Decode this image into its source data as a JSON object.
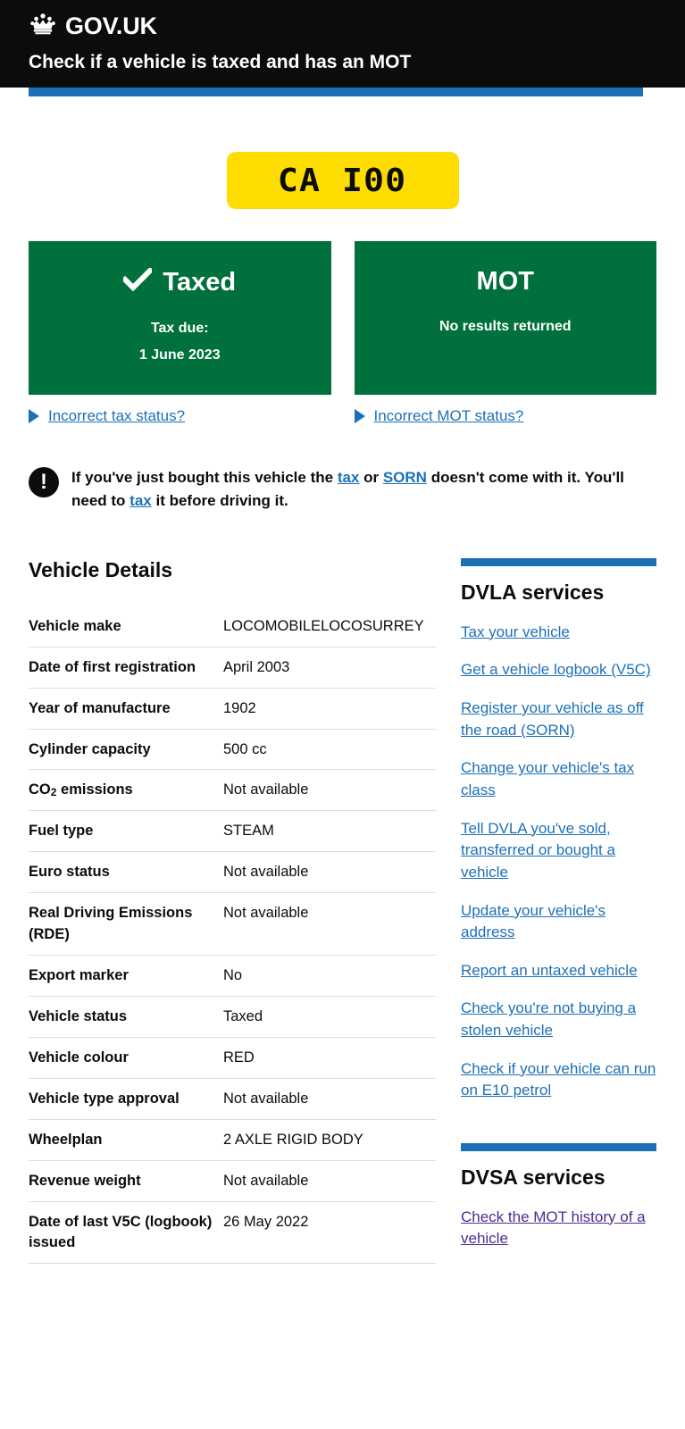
{
  "header": {
    "crown_icon": "crown-icon",
    "brand": "GOV.UK",
    "service_name": "Check if a vehicle is taxed and has an MOT"
  },
  "plate": {
    "registration": "CA I00"
  },
  "status": {
    "tax": {
      "icon": "tick-icon",
      "title": "Taxed",
      "sub_label": "Tax due:",
      "sub_value": "1 June 2023",
      "details_link": "Incorrect tax status?",
      "arrow_icon": "disclosure-arrow-icon"
    },
    "mot": {
      "title": "MOT",
      "sub_label": "No results returned",
      "details_link": "Incorrect MOT status?",
      "arrow_icon": "disclosure-arrow-icon"
    }
  },
  "warning": {
    "icon": "warning-exclamation-icon",
    "text_part_1": "If you've just bought this vehicle the ",
    "link_tax_1": "tax",
    "text_part_2": " or ",
    "link_sorn": "SORN",
    "text_part_3": " doesn't come with it. You'll need to ",
    "link_tax_2": "tax",
    "text_part_4": " it before driving it."
  },
  "vehicle_details": {
    "heading": "Vehicle Details",
    "rows": [
      {
        "label": "Vehicle make",
        "value": "LOCOMOBILELOCOSURREY"
      },
      {
        "label": "Date of first registration",
        "value": "April 2003"
      },
      {
        "label": "Year of manufacture",
        "value": "1902"
      },
      {
        "label": "Cylinder capacity",
        "value": "500 cc"
      },
      {
        "label": "CO2 emissions",
        "value": "Not available"
      },
      {
        "label": "Fuel type",
        "value": "STEAM"
      },
      {
        "label": "Euro status",
        "value": "Not available"
      },
      {
        "label": "Real Driving Emissions (RDE)",
        "value": "Not available"
      },
      {
        "label": "Export marker",
        "value": "No"
      },
      {
        "label": "Vehicle status",
        "value": "Taxed"
      },
      {
        "label": "Vehicle colour",
        "value": "RED"
      },
      {
        "label": "Vehicle type approval",
        "value": "Not available"
      },
      {
        "label": "Wheelplan",
        "value": "2 AXLE RIGID BODY"
      },
      {
        "label": "Revenue weight",
        "value": "Not available"
      },
      {
        "label": "Date of last V5C (logbook) issued",
        "value": "26 May 2022"
      }
    ]
  },
  "sidebar": {
    "dvla": {
      "heading": "DVLA services",
      "links": [
        "Tax your vehicle",
        "Get a vehicle logbook (V5C)",
        "Register your vehicle as off the road (SORN)",
        "Change your vehicle's tax class",
        "Tell DVLA you've sold, transferred or bought a vehicle",
        "Update your vehicle's address",
        "Report an untaxed vehicle",
        "Check you're not buying a stolen vehicle",
        "Check if your vehicle can run on E10 petrol"
      ]
    },
    "dvsa": {
      "heading": "DVSA services",
      "links": [
        "Check the MOT history of a vehicle"
      ]
    }
  },
  "colors": {
    "black": "#0b0c0c",
    "blue": "#1d70b8",
    "green": "#00703c",
    "yellow": "#ffdd00",
    "visited_link": "#4c2c92"
  }
}
